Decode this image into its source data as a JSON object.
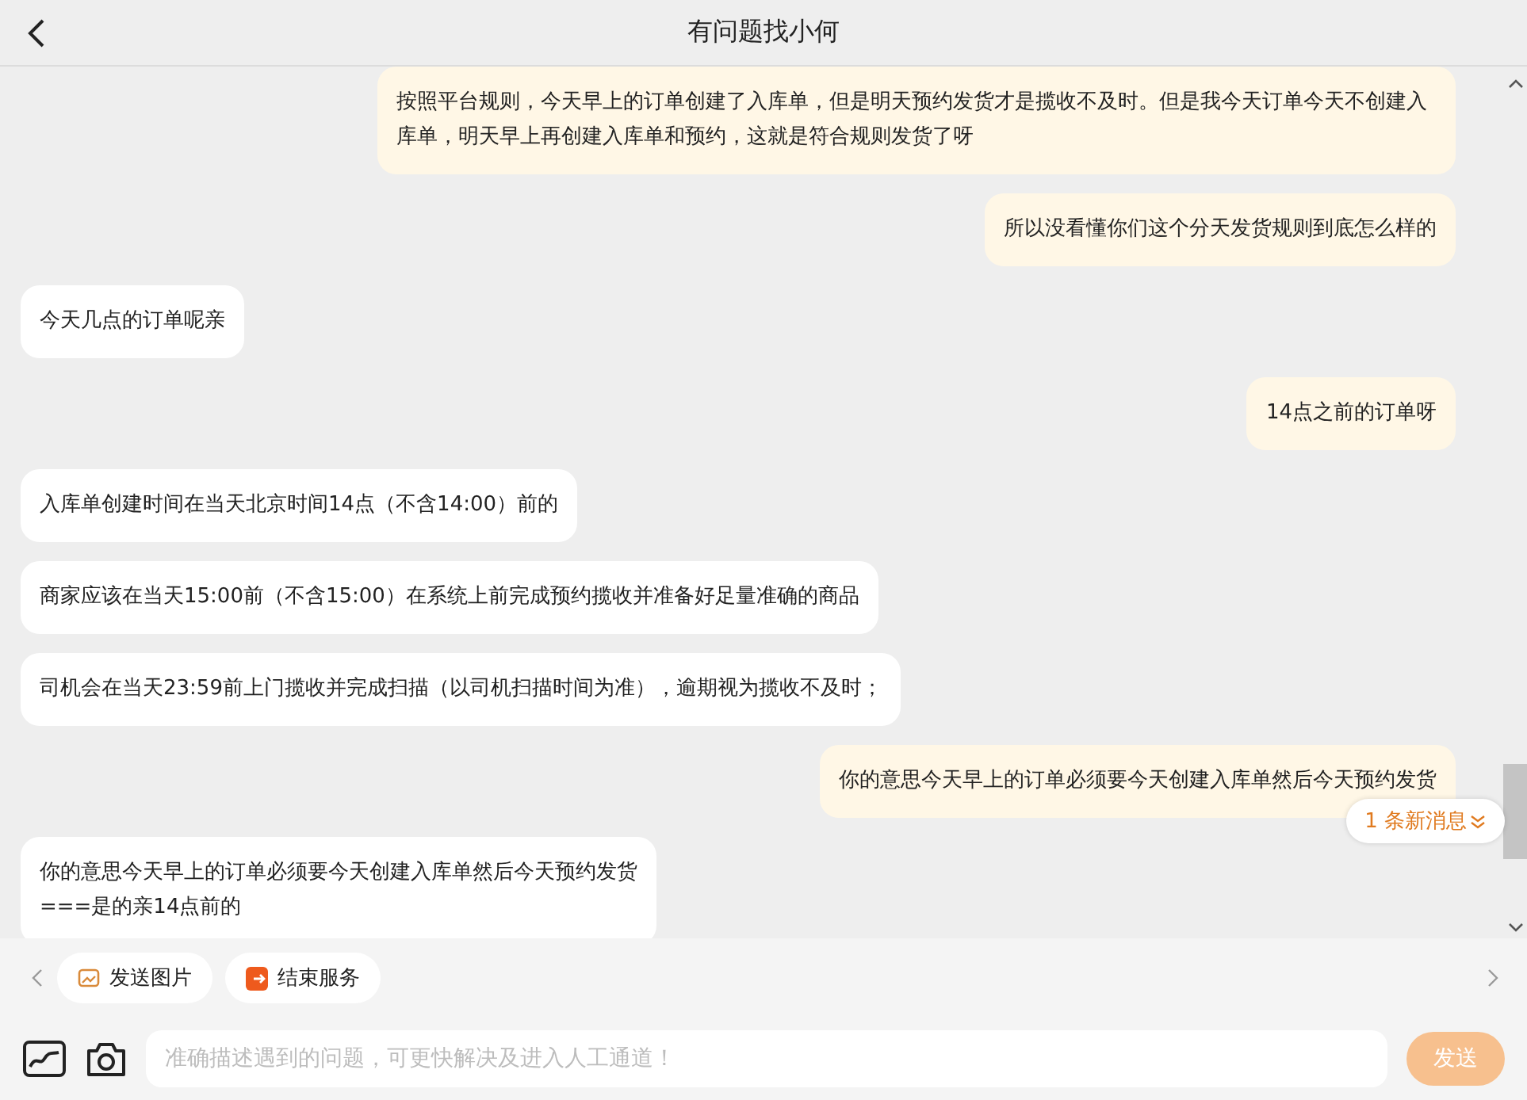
{
  "header": {
    "title": "有问题找小何"
  },
  "messages": [
    {
      "kind": "sent",
      "text": "按照平台规则，今天早上的订单创建了入库单，但是明天预约发货才是揽收不及时。但是我今天订单今天不创建入库单，明天早上再创建入库单和预约，这就是符合规则发货了呀"
    },
    {
      "kind": "sent",
      "text": "所以没看懂你们这个分天发货规则到底怎么样的"
    },
    {
      "kind": "received",
      "text": "今天几点的订单呢亲"
    },
    {
      "kind": "sent",
      "text": "14点之前的订单呀"
    },
    {
      "kind": "received",
      "text": "入库单创建时间在当天北京时间14点（不含14:00）前的"
    },
    {
      "kind": "received",
      "text": "商家应该在当天15:00前（不含15:00）在系统上前完成预约揽收并准备好足量准确的商品"
    },
    {
      "kind": "received",
      "text": "司机会在当天23:59前上门揽收并完成扫描（以司机扫描时间为准），逾期视为揽收不及时；"
    },
    {
      "kind": "sent",
      "text": "你的意思今天早上的订单必须要今天创建入库单然后今天预约发货"
    },
    {
      "kind": "received",
      "text": "你的意思今天早上的订单必须要今天创建入库单然后今天预约发货\n===是的亲14点前的"
    }
  ],
  "new_message_badge": "1 条新消息",
  "quick_actions": [
    {
      "kind": "image",
      "label": "发送图片"
    },
    {
      "kind": "end",
      "label": "结束服务"
    }
  ],
  "input": {
    "placeholder": "准确描述遇到的问题，可更快解决及进入人工通道！"
  },
  "send_button": "发送"
}
